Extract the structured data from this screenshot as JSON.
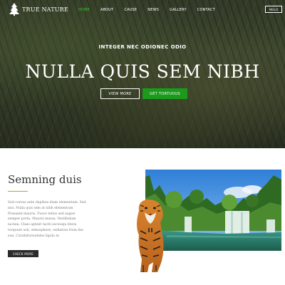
{
  "nav": {
    "logo_text": "TRUE NATURE",
    "items": [
      {
        "label": "HOME",
        "active": true
      },
      {
        "label": "ABOUT",
        "active": false
      },
      {
        "label": "CAUSE",
        "active": false
      },
      {
        "label": "NEWS",
        "active": false
      },
      {
        "label": "GALLERY",
        "active": false
      },
      {
        "label": "CONTACT",
        "active": false
      }
    ],
    "hello_label": "HELLO"
  },
  "hero": {
    "subtitle": "INTEGER NEC ODIONEC ODIO",
    "title": "NULLA QUIS SEM NIBH",
    "view_more_label": "VIEW MORE",
    "get_label": "GET TORTUOUS"
  },
  "section": {
    "title": "Semning duis",
    "body": "Sed cursus ante dapibus diam elementum. Sed nisi. Nulla quis sem at nibh elementum Praesent mauris. Fusce tellus sed augue semper porta. Mauris massa. Vestibulum lacinia. Class aptent taciti sociosqu litora torquent soli, atmosphere, radiation from the sun. Curabitursodales ligula in.",
    "button_label": "CHECK MORE"
  },
  "colors": {
    "accent_green": "#1a9c1a",
    "nav_active": "#3fbf3a",
    "rule_gold": "#b9a23a"
  }
}
